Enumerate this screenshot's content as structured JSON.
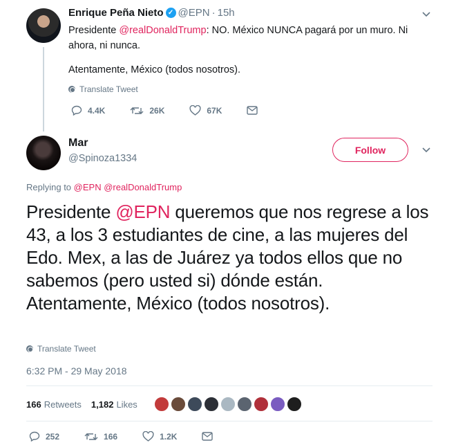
{
  "tweet1": {
    "name": "Enrique Peña Nieto",
    "handle": "@EPN",
    "dot": "·",
    "time": "15h",
    "body_prefix": "Presidente ",
    "body_mention": "@realDonaldTrump",
    "body_rest": ": NO. México NUNCA pagará por un muro. Ni ahora, ni nunca.",
    "sign": "Atentamente, México (todos nosotros).",
    "translate": "Translate Tweet",
    "replies": "4.4K",
    "retweets": "26K",
    "likes": "67K"
  },
  "tweet2": {
    "name": "Mar",
    "handle": "@Spinoza1334",
    "follow_label": "Follow",
    "replying_prefix": "Replying to ",
    "replying_mentions": "@EPN @realDonaldTrump",
    "body_prefix": "Presidente ",
    "body_mention": "@EPN",
    "body_rest": " queremos que nos regrese a los 43, a los 3 estudiantes de cine, a las mujeres del Edo. Mex, a las de Juárez ya todos ellos que no sabemos (pero usted si) dónde están.",
    "body_sign": "Atentamente, México (todos nosotros).",
    "translate": "Translate Tweet",
    "timestamp": "6:32 PM - 29 May 2018",
    "retweet_count": "166",
    "retweet_label": "Retweets",
    "like_count": "1,182",
    "like_label": "Likes",
    "replies": "252",
    "retweets": "166",
    "likes": "1.2K"
  },
  "colors": {
    "accent": "#e0245e",
    "muted": "#657786",
    "verified": "#1da1f2"
  },
  "icons": [
    "verified-badge-icon",
    "chevron-down-icon",
    "globe-icon",
    "reply-icon",
    "retweet-icon",
    "heart-icon",
    "message-icon"
  ]
}
